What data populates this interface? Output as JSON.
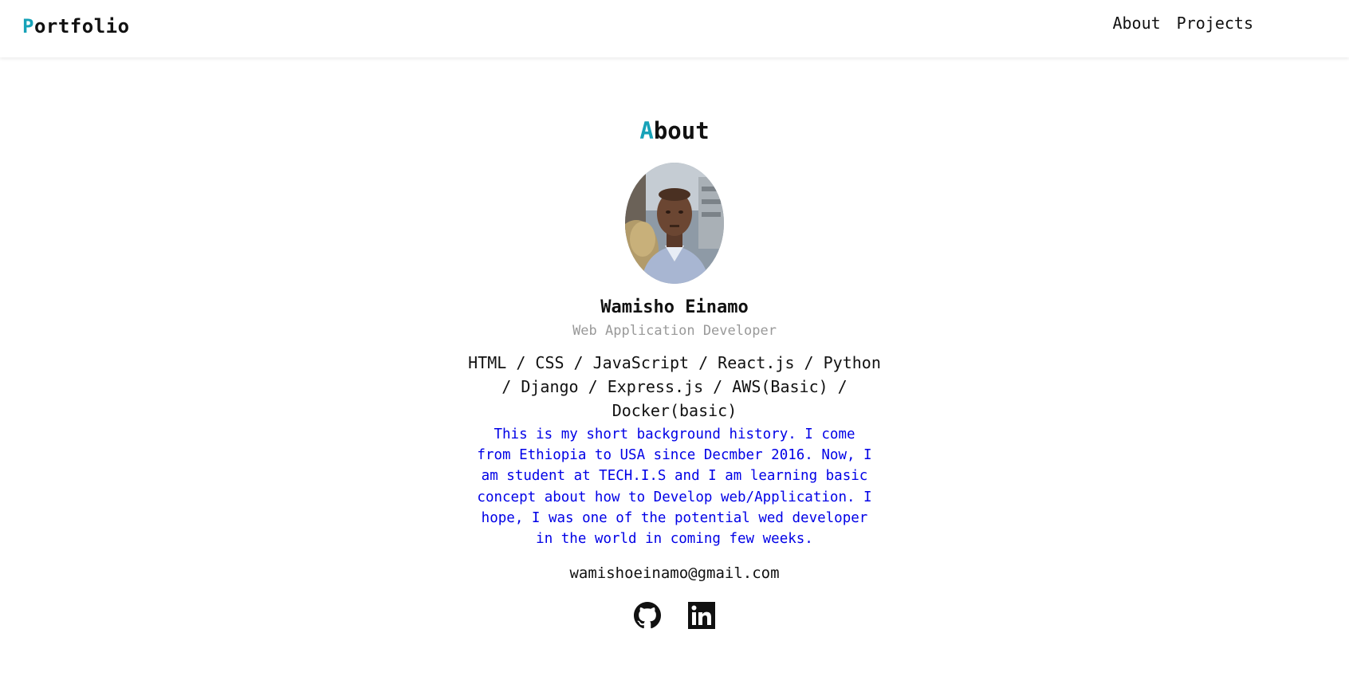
{
  "navbar": {
    "brand_first_letter": "P",
    "brand_rest": "ortfolio",
    "links": [
      "About",
      "Projects"
    ]
  },
  "about": {
    "title_first_letter": "A",
    "title_rest": "bout",
    "avatar_alt": "Wamisho Einamo",
    "name": "Wamisho Einamo",
    "role": "Web Application Developer",
    "skills": "HTML / CSS / JavaScript / React.js / Python / Django / Express.js / AWS(Basic) / Docker(basic)",
    "bio": "This is my short background history. I come from Ethiopia to USA since Decmber 2016. Now, I am student at TECH.I.S and I am learning basic concept about how to Develop web/Application. I hope, I was one of the potential wed developer in the world in coming few weeks.",
    "email": "wamishoeinamo@gmail.com",
    "socials": [
      "github-icon",
      "linkedin-icon"
    ]
  },
  "colors": {
    "accent": "#17a2b8",
    "bio_text": "#0000e6",
    "role_text": "#999999"
  }
}
